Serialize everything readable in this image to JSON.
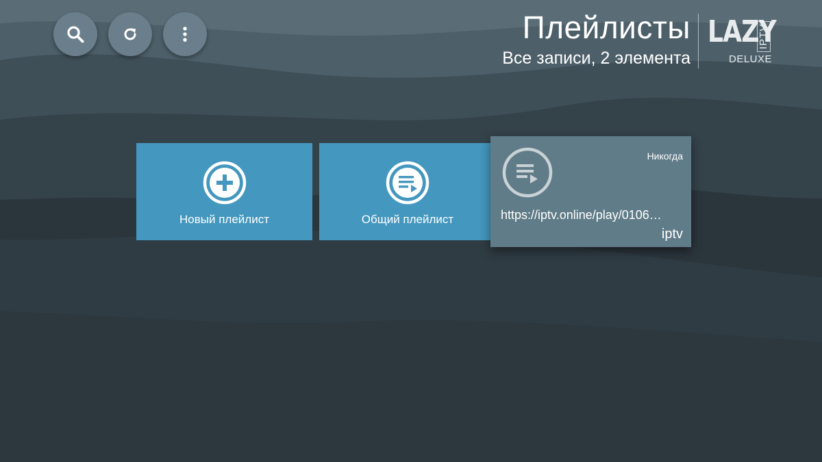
{
  "header": {
    "title": "Плейлисты",
    "subtitle": "Все записи, 2 элемента"
  },
  "logo": {
    "word": "LAZY",
    "iptv": "IPTV",
    "edition": "DELUXE"
  },
  "toolbar": {
    "buttons": [
      {
        "icon": "search-icon"
      },
      {
        "icon": "refresh-icon"
      },
      {
        "icon": "more-vertical-icon"
      }
    ]
  },
  "actions": {
    "new_playlist_label": "Новый плейлист",
    "common_playlist_label": "Общий плейлист"
  },
  "playlists": [
    {
      "updated": "Никогда",
      "url": "https://iptv.online/play/0106…",
      "name": "iptv"
    }
  ],
  "colors": {
    "background_dark": "#2b353c",
    "action_card": "#4497be",
    "selected_card": "#607c88",
    "round_button": "#6a7f8b"
  }
}
